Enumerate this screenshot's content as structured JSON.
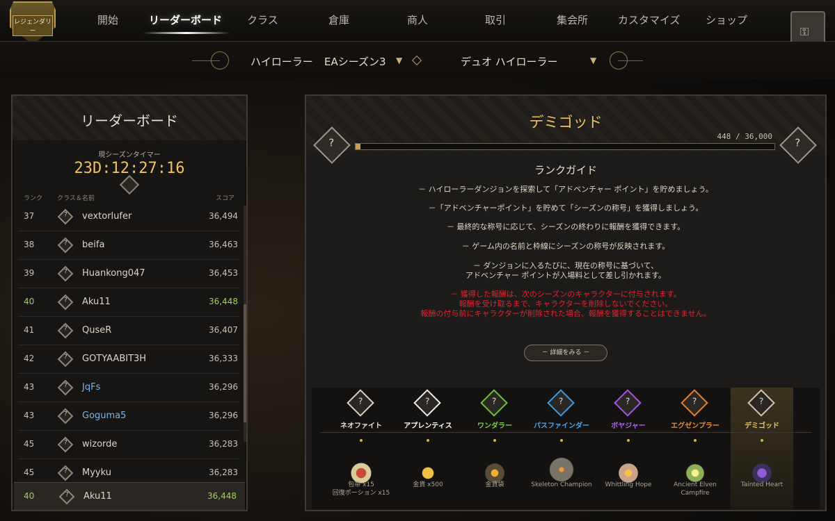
{
  "header": {
    "emblem_label": "レジェンダリー",
    "nav": [
      "開始",
      "リーダーボード",
      "クラス",
      "倉庫",
      "商人",
      "取引",
      "集会所",
      "カスタマイズ",
      "ショップ"
    ],
    "active_index": 1
  },
  "filters": {
    "mode": "ハイローラー",
    "season": "EAシーズン3",
    "bracket": "デュオ ハイローラー"
  },
  "leaderboard": {
    "title": "リーダーボード",
    "timer_label": "現シーズンタイマー",
    "timer": "23D:12:27:16",
    "col_rank": "ランク",
    "col_class": "クラス＆名前",
    "col_score": "スコア",
    "rows": [
      {
        "rank": "37",
        "name": "vextorlufer",
        "score": "36,494"
      },
      {
        "rank": "38",
        "name": "beifa",
        "score": "36,463"
      },
      {
        "rank": "39",
        "name": "Huankong047",
        "score": "36,453"
      },
      {
        "rank": "40",
        "name": "Aku11",
        "score": "36,448"
      },
      {
        "rank": "41",
        "name": "QuseR",
        "score": "36,407"
      },
      {
        "rank": "42",
        "name": "GOTYAABIT3H",
        "score": "36,333"
      },
      {
        "rank": "43",
        "name": "JqFs",
        "score": "36,296"
      },
      {
        "rank": "43",
        "name": "Goguma5",
        "score": "36,296"
      },
      {
        "rank": "45",
        "name": "wizorde",
        "score": "36,283"
      },
      {
        "rank": "45",
        "name": "Myyku",
        "score": "36,283"
      }
    ],
    "me": {
      "rank": "40",
      "name": "Aku11",
      "score": "36,448"
    }
  },
  "rank_panel": {
    "title": "デミゴッド",
    "points": "448 / 36,000",
    "progress_fraction": 0.0124,
    "guide_title": "ランクガイド",
    "lines": [
      "－ ハイローラーダンジョンを探索して「アドベンチャー ポイント」を貯めましょう。",
      "－「アドベンチャーポイント」を貯めて「シーズンの称号」を獲得しましょう。",
      "－  最終的な称号に応じて、シーズンの終わりに報酬を獲得できます。",
      "－  ゲーム内の名前と枠線にシーズンの称号が反映されます。",
      "－  ダンジョンに入るたびに、現在の称号に基づいて、",
      "アドベンチャー ポイントが入場料として差し引かれます。"
    ],
    "warnings": [
      "－  獲得した報酬は、次のシーズンのキャラクターに付与されます。",
      "報酬を受け取るまで、キャラクターを削除しないでください。",
      "報酬の付与前にキャラクターが削除された場合、報酬を獲得することはできません。"
    ],
    "more_button": "－ 詳細をみる －",
    "tiers": [
      {
        "name": "ネオファイト",
        "color": "#e6e0d4",
        "reward": [
          "包帯 x15",
          "回復ポーション x15"
        ]
      },
      {
        "name": "アプレンティス",
        "color": "#ffffff",
        "reward": [
          "金貨 x500"
        ]
      },
      {
        "name": "ワンダラー",
        "color": "#7ad13b",
        "reward": [
          "金貨袋"
        ]
      },
      {
        "name": "パスファインダー",
        "color": "#45a8f0",
        "reward": [
          "Skeleton Champion"
        ]
      },
      {
        "name": "ボヤジャー",
        "color": "#b05ff0",
        "reward": [
          "Whittling Hope"
        ]
      },
      {
        "name": "エグゼンプラー",
        "color": "#f08a2c",
        "reward": [
          "Ancient Elven",
          "Campfire"
        ]
      },
      {
        "name": "デミゴッド",
        "color": "#f2c24a",
        "reward": [
          "Tainted Heart"
        ]
      }
    ]
  }
}
